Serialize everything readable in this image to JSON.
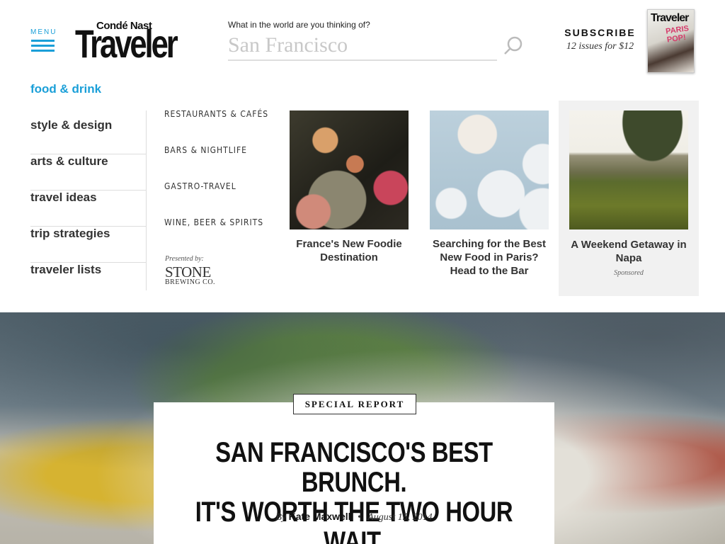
{
  "header": {
    "menu_label": "MENU",
    "logo_top": "Condé Nast",
    "logo_main": "Traveler",
    "search": {
      "label": "What in the world are you thinking of?",
      "placeholder": "San Francisco"
    },
    "subscribe": {
      "title": "SUBSCRIBE",
      "offer": "12 issues for $12"
    },
    "magazine": {
      "title": "Traveler",
      "tag": "PARIS POP!"
    }
  },
  "nav": {
    "categories": [
      {
        "label": "food & drink",
        "active": true
      },
      {
        "label": "style & design"
      },
      {
        "label": "arts & culture"
      },
      {
        "label": "travel ideas"
      },
      {
        "label": "trip strategies"
      },
      {
        "label": "traveler lists"
      }
    ],
    "subcategories": [
      "RESTAURANTS & CAFÉS",
      "BARS & NIGHTLIFE",
      "GASTRO-TRAVEL",
      "WINE, BEER & SPIRITS"
    ],
    "presented_by": "Presented by:",
    "sponsor": {
      "name": "STONE",
      "sub": "BREWING CO."
    }
  },
  "cards": [
    {
      "title": "France's New Foodie Destination"
    },
    {
      "title": "Searching for the Best New Food in Paris? Head to the Bar"
    },
    {
      "title": "A Weekend Getaway in Napa",
      "tag": "Sponsored"
    }
  ],
  "article": {
    "badge": "SPECIAL REPORT",
    "headline_line1": "SAN FRANCISCO'S BEST BRUNCH.",
    "headline_line2": "IT'S WORTH THE TWO HOUR WAIT.",
    "by": "By",
    "author": "Kate Maxwell",
    "date": "August 15, 2014"
  },
  "colors": {
    "accent": "#1a9fd8"
  }
}
